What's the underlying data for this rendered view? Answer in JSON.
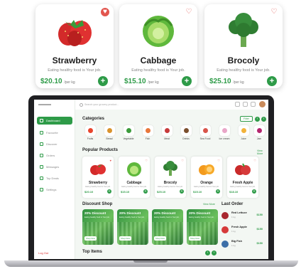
{
  "colors": {
    "accent": "#2e9b48",
    "heart": "#e2564f"
  },
  "top_cards": [
    {
      "name": "Strawberry",
      "desc": "Eating healthy food is Your job.",
      "price": "$20.10",
      "unit": "/per kg",
      "favorite": true
    },
    {
      "name": "Cabbage",
      "desc": "Eating healthy food is Your job.",
      "price": "$15.10",
      "unit": "/per kg",
      "favorite": false
    },
    {
      "name": "Brocoly",
      "desc": "Eating healthy food is Your job.",
      "price": "$25.10",
      "unit": "/per kg",
      "favorite": false
    }
  ],
  "dashboard": {
    "search_placeholder": "Search your grocery product...",
    "sidebar": [
      "Dashboard",
      "Favourite",
      "Discover",
      "Orders",
      "Messages",
      "Top Deals",
      "Settings"
    ],
    "logout": "Log Out",
    "categories_title": "Categories",
    "filter_label": "Filter",
    "categories": [
      "Fruits",
      "Bread",
      "Vegetable",
      "Fish",
      "Meat",
      "Drinks",
      "Sea Food",
      "Ice cream",
      "Juice",
      "Jam"
    ],
    "popular_title": "Popular Products",
    "view_more": "View More",
    "popular": [
      {
        "name": "Strawberry",
        "price": "$20.10"
      },
      {
        "name": "Cabbage",
        "price": "$15.10"
      },
      {
        "name": "Brocoly",
        "price": "$25.10"
      },
      {
        "name": "Orange",
        "price": "$15.10"
      },
      {
        "name": "Fresh Apple",
        "price": "$18.10"
      }
    ],
    "product_desc": "Eating healthy food is Your job.",
    "discount_title": "Discount Shop",
    "discounts": [
      {
        "title": "20% Discount",
        "button": "Shop Now"
      },
      {
        "title": "20% Discount",
        "button": "Shop Now"
      },
      {
        "title": "20% Discount",
        "button": "Shop Now"
      },
      {
        "title": "20% Discount",
        "button": "Shop Now"
      }
    ],
    "last_order_title": "Last Order",
    "orders": [
      {
        "name": "Red Lettuce",
        "qty": "1 kg",
        "price": "$150"
      },
      {
        "name": "Fresh Apple",
        "qty": "1 kg",
        "price": "$150"
      },
      {
        "name": "Big Fish",
        "qty": "1 kg",
        "price": "$150"
      }
    ],
    "top_items_title": "Top Items"
  }
}
